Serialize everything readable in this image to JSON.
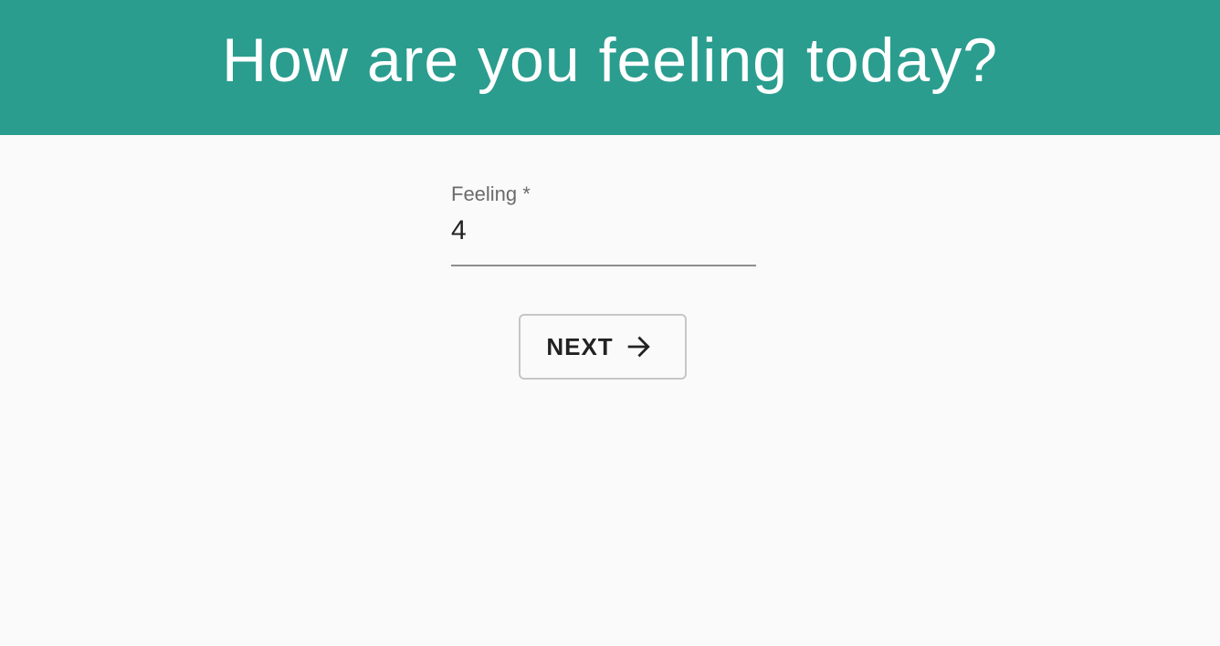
{
  "header": {
    "title": "How are you feeling today?",
    "background_color": "#2a9d8f"
  },
  "form": {
    "feeling_field": {
      "label": "Feeling *",
      "value": "4",
      "required": true
    }
  },
  "actions": {
    "next_label": "NEXT",
    "next_icon": "arrow-right-icon"
  }
}
